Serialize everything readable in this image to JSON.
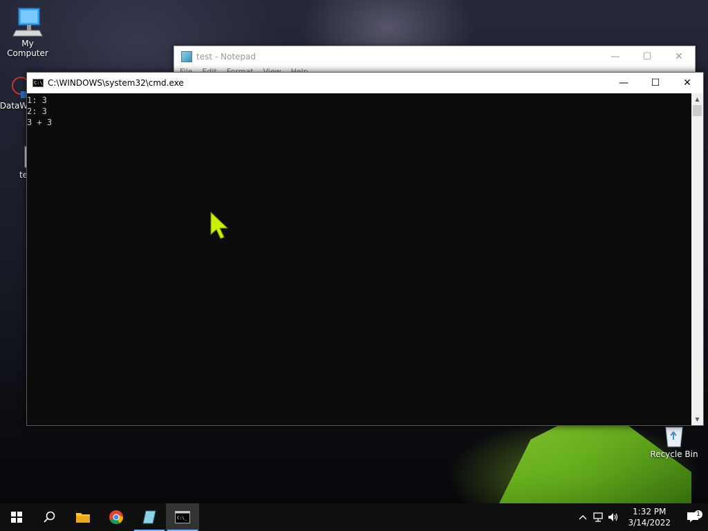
{
  "desktop": {
    "icons": {
      "my_computer": "My Computer",
      "dataw": "DataW",
      "te": "te",
      "recycle_bin": "Recycle Bin"
    }
  },
  "notepad": {
    "title": "test - Notepad",
    "menu": [
      "File",
      "Edit",
      "Format",
      "View",
      "Help"
    ]
  },
  "cmd": {
    "title": "C:\\WINDOWS\\system32\\cmd.exe",
    "lines": [
      "1: 3",
      "2: 3",
      "3 + 3"
    ]
  },
  "window_controls": {
    "minimize": "—",
    "maximize": "☐",
    "close": "✕"
  },
  "taskbar": {
    "time": "1:32 PM",
    "date": "3/14/2022",
    "notification_count": "1"
  },
  "colors": {
    "console_bg": "#0c0c0c",
    "console_text": "#cccccc",
    "taskbar_bg": "#0f0f0f",
    "active_accent": "#7fb2ff",
    "cursor": "#c8f000"
  }
}
